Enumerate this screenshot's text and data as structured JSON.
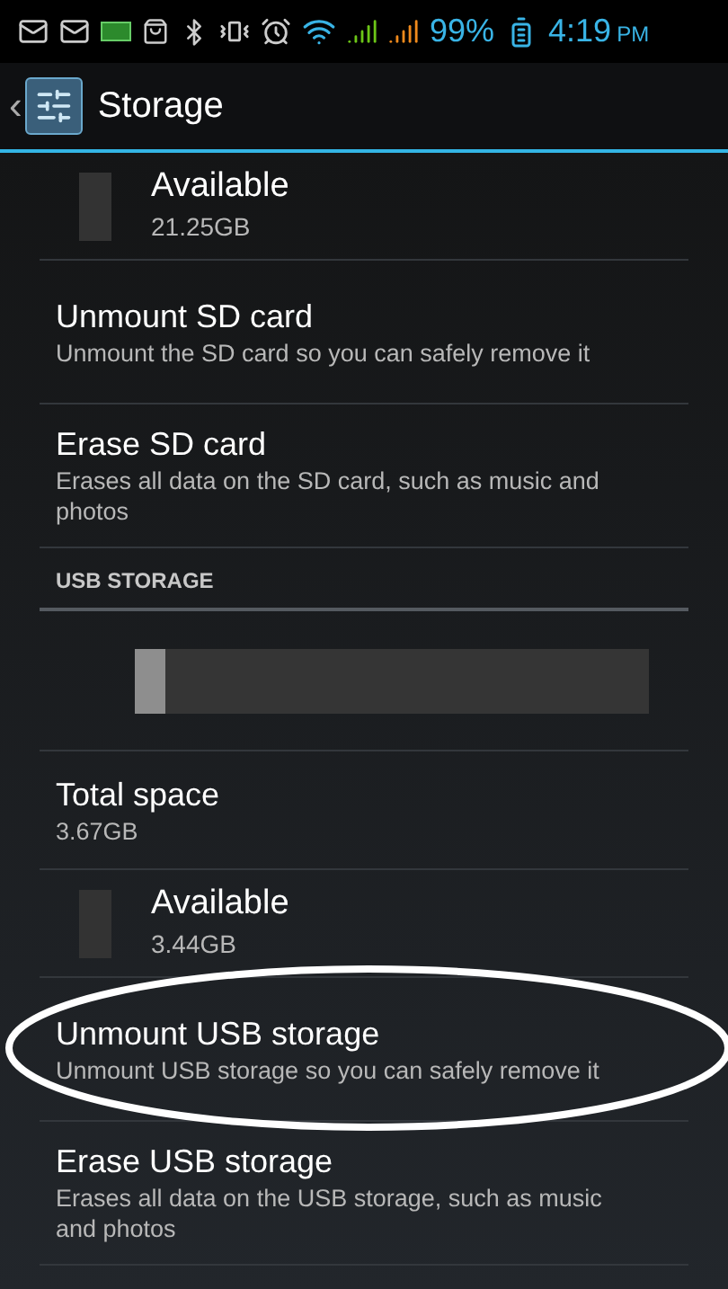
{
  "status_bar": {
    "battery": "99%",
    "time": "4:19",
    "ampm": "PM"
  },
  "action_bar": {
    "back": "‹",
    "title": "Storage"
  },
  "items": [
    {
      "kind": "legend",
      "title": "Available",
      "summary": "21.25GB"
    },
    {
      "kind": "action",
      "title": "Unmount SD card",
      "summary": "Unmount the SD card so you can safely remove it",
      "circled": false
    },
    {
      "kind": "action",
      "title": "Erase SD card",
      "summary": "Erases all data on the SD card, such as music and photos",
      "circled": false
    },
    {
      "kind": "header",
      "title": "USB STORAGE"
    },
    {
      "kind": "bar",
      "level": 0.06
    },
    {
      "kind": "total",
      "title": "Total space",
      "summary": "3.67GB"
    },
    {
      "kind": "legend",
      "title": "Available",
      "summary": "3.44GB"
    },
    {
      "kind": "action",
      "title": "Unmount USB storage",
      "summary": "Unmount USB storage so you can safely remove it",
      "circled": true
    },
    {
      "kind": "action",
      "title": "Erase USB storage",
      "summary": "Erases all data on the USB storage, such as music and photos",
      "circled": false
    }
  ]
}
